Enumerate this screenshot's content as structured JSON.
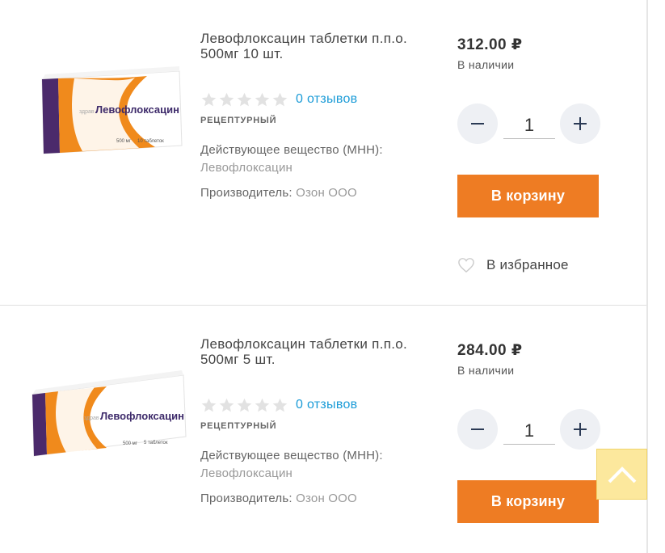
{
  "products": [
    {
      "title": "Левофлоксацин таблетки п.п.о. 500мг 10 шт.",
      "reviews": "0 отзывов",
      "prescription": "РЕЦЕПТУРНЫЙ",
      "mnn_label": "Действующее вещество (МНН):",
      "mnn_value": "Левофлоксацин",
      "maker_label": "Производитель:",
      "maker_value": "Озон ООО",
      "price": "312.00 ₽",
      "stock": "В наличии",
      "quantity": "1",
      "cart_label": "В корзину",
      "favorite_label": "В избранное",
      "box": {
        "brand_prefix": "здрав",
        "brand": "Левофлоксацин",
        "dose": "500 мг",
        "count": "10 таблеток"
      }
    },
    {
      "title": "Левофлоксацин таблетки п.п.о. 500мг 5 шт.",
      "reviews": "0 отзывов",
      "prescription": "РЕЦЕПТУРНЫЙ",
      "mnn_label": "Действующее вещество (МНН):",
      "mnn_value": "Левофлоксацин",
      "maker_label": "Производитель:",
      "maker_value": "Озон ООО",
      "price": "284.00 ₽",
      "stock": "В наличии",
      "quantity": "1",
      "cart_label": "В корзину",
      "box": {
        "brand_prefix": "здрав",
        "brand": "Левофлоксацин",
        "dose": "500 мг",
        "count": "5 таблеток"
      }
    }
  ],
  "icons": {
    "star": "star-icon",
    "minus": "minus-icon",
    "plus": "plus-icon",
    "heart": "heart-icon",
    "scroll_top": "chevron-up-icon"
  },
  "colors": {
    "accent": "#ee7c23",
    "link": "#1a9bd7",
    "star_empty": "#e2e2e2",
    "scroll_top_bg": "#fce89d",
    "box_purple": "#4b2a6b",
    "box_orange": "#f08a1c"
  }
}
